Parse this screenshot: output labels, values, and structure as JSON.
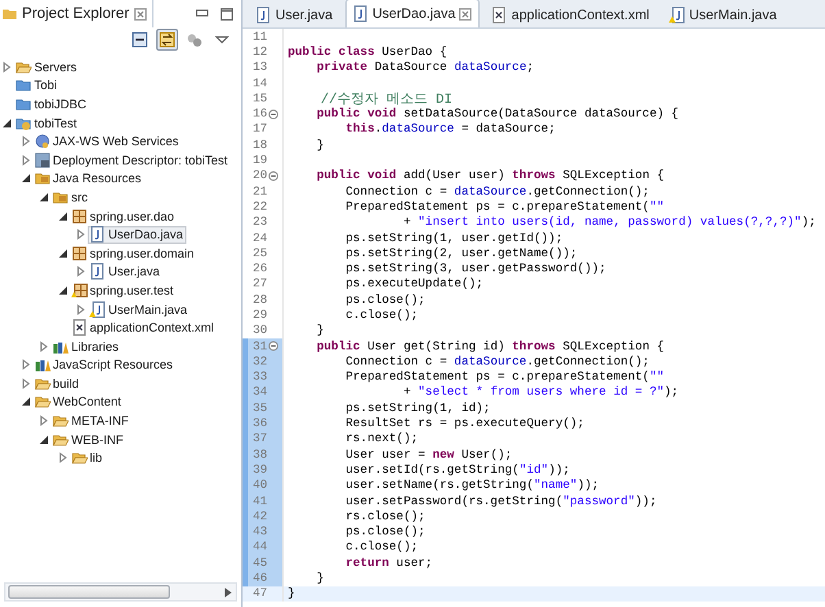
{
  "explorer": {
    "title": "Project Explorer",
    "toolbar": [
      {
        "kind": "collapse-all",
        "pressed": false
      },
      {
        "kind": "link-editor",
        "pressed": true
      },
      {
        "kind": "filters",
        "pressed": false
      },
      {
        "kind": "view-menu",
        "pressed": false
      }
    ],
    "tree": [
      {
        "label": "Servers",
        "kind": "open-folder",
        "expanded": false,
        "selected": false
      },
      {
        "label": "Tobi",
        "kind": "project",
        "selected": false
      },
      {
        "label": "tobiJDBC",
        "kind": "project",
        "selected": false
      },
      {
        "label": "tobiTest",
        "kind": "web-project",
        "expanded": true,
        "selected": false,
        "children": [
          {
            "label": "JAX-WS Web Services",
            "kind": "web-services",
            "expanded": false,
            "selected": false
          },
          {
            "label": "Deployment Descriptor: tobiTest",
            "kind": "descriptor",
            "expanded": false,
            "selected": false
          },
          {
            "label": "Java Resources",
            "kind": "java-resources",
            "expanded": true,
            "selected": false,
            "children": [
              {
                "label": "src",
                "kind": "source-folder",
                "expanded": true,
                "selected": false,
                "children": [
                  {
                    "label": "spring.user.dao",
                    "kind": "package",
                    "expanded": true,
                    "selected": false,
                    "children": [
                      {
                        "label": "UserDao.java",
                        "kind": "java-file",
                        "expanded": false,
                        "selected": true
                      }
                    ]
                  },
                  {
                    "label": "spring.user.domain",
                    "kind": "package",
                    "expanded": true,
                    "selected": false,
                    "children": [
                      {
                        "label": "User.java",
                        "kind": "java-file",
                        "expanded": false,
                        "selected": false
                      }
                    ]
                  },
                  {
                    "label": "spring.user.test",
                    "kind": "package-warning",
                    "expanded": true,
                    "selected": false,
                    "children": [
                      {
                        "label": "UserMain.java",
                        "kind": "java-file-warning",
                        "expanded": false,
                        "selected": false
                      }
                    ]
                  },
                  {
                    "label": "applicationContext.xml",
                    "kind": "xml-file",
                    "selected": false
                  }
                ]
              },
              {
                "label": "Libraries",
                "kind": "libraries",
                "expanded": false,
                "selected": false
              }
            ]
          },
          {
            "label": "JavaScript Resources",
            "kind": "libraries",
            "expanded": false,
            "selected": false
          },
          {
            "label": "build",
            "kind": "open-folder",
            "expanded": false,
            "selected": false
          },
          {
            "label": "WebContent",
            "kind": "open-folder",
            "expanded": true,
            "selected": false,
            "children": [
              {
                "label": "META-INF",
                "kind": "open-folder",
                "expanded": false,
                "selected": false
              },
              {
                "label": "WEB-INF",
                "kind": "open-folder",
                "expanded": true,
                "selected": false,
                "children": [
                  {
                    "label": "lib",
                    "kind": "open-folder",
                    "expanded": false,
                    "selected": false
                  }
                ]
              }
            ]
          }
        ]
      }
    ]
  },
  "editor": {
    "tabs": [
      {
        "label": "User.java",
        "kind": "java",
        "selected": false
      },
      {
        "label": "UserDao.java",
        "kind": "java",
        "selected": true
      },
      {
        "label": "applicationContext.xml",
        "kind": "xml",
        "selected": false
      },
      {
        "label": "UserMain.java",
        "kind": "java-warning",
        "selected": false
      }
    ],
    "lines": [
      {
        "number": "11",
        "fold": false,
        "marked": false,
        "current": false
      },
      {
        "number": "12",
        "fold": false,
        "marked": false,
        "current": false,
        "code": [
          {
            "kind": "kw",
            "text": "public class"
          },
          {
            "kind": "plain",
            "text": " UserDao {"
          }
        ]
      },
      {
        "number": "13",
        "fold": false,
        "marked": false,
        "current": false,
        "code": [
          {
            "kind": "kw",
            "text": "    private"
          },
          {
            "kind": "plain",
            "text": " DataSource "
          },
          {
            "kind": "field",
            "text": "dataSource"
          },
          {
            "kind": "plain",
            "text": ";"
          }
        ]
      },
      {
        "number": "14",
        "fold": false,
        "marked": false,
        "current": false
      },
      {
        "number": "15",
        "fold": false,
        "marked": false,
        "current": false,
        "code": [
          {
            "kind": "comment",
            "text": "    //수정자 메소드 DI"
          }
        ]
      },
      {
        "number": "16",
        "fold": true,
        "marked": false,
        "current": false,
        "code": [
          {
            "kind": "kw",
            "text": "    public void"
          },
          {
            "kind": "plain",
            "text": " setDataSource(DataSource dataSource) {"
          }
        ]
      },
      {
        "number": "17",
        "fold": false,
        "marked": false,
        "current": false,
        "code": [
          {
            "kind": "kw",
            "text": "        this"
          },
          {
            "kind": "plain",
            "text": "."
          },
          {
            "kind": "field",
            "text": "dataSource"
          },
          {
            "kind": "plain",
            "text": " = dataSource;"
          }
        ]
      },
      {
        "number": "18",
        "fold": false,
        "marked": false,
        "current": false,
        "code": [
          {
            "kind": "plain",
            "text": "    }"
          }
        ]
      },
      {
        "number": "19",
        "fold": false,
        "marked": false,
        "current": false
      },
      {
        "number": "20",
        "fold": true,
        "marked": false,
        "current": false,
        "code": [
          {
            "kind": "kw",
            "text": "    public void"
          },
          {
            "kind": "plain",
            "text": " add(User user) "
          },
          {
            "kind": "kw",
            "text": "throws"
          },
          {
            "kind": "plain",
            "text": " SQLException {"
          }
        ]
      },
      {
        "number": "21",
        "fold": false,
        "marked": false,
        "current": false,
        "code": [
          {
            "kind": "plain",
            "text": "        Connection c = "
          },
          {
            "kind": "field",
            "text": "dataSource"
          },
          {
            "kind": "plain",
            "text": ".getConnection();"
          }
        ]
      },
      {
        "number": "22",
        "fold": false,
        "marked": false,
        "current": false,
        "code": [
          {
            "kind": "plain",
            "text": "        PreparedStatement ps = c.prepareStatement("
          },
          {
            "kind": "str",
            "text": "\"\""
          }
        ]
      },
      {
        "number": "23",
        "fold": false,
        "marked": false,
        "current": false,
        "code": [
          {
            "kind": "plain",
            "text": "                + "
          },
          {
            "kind": "str",
            "text": "\"insert into users(id, name, password) values(?,?,?)\""
          },
          {
            "kind": "plain",
            "text": ");"
          }
        ]
      },
      {
        "number": "24",
        "fold": false,
        "marked": false,
        "current": false,
        "code": [
          {
            "kind": "plain",
            "text": "        ps.setString(1, user.getId());"
          }
        ]
      },
      {
        "number": "25",
        "fold": false,
        "marked": false,
        "current": false,
        "code": [
          {
            "kind": "plain",
            "text": "        ps.setString(2, user.getName());"
          }
        ]
      },
      {
        "number": "26",
        "fold": false,
        "marked": false,
        "current": false,
        "code": [
          {
            "kind": "plain",
            "text": "        ps.setString(3, user.getPassword());"
          }
        ]
      },
      {
        "number": "27",
        "fold": false,
        "marked": false,
        "current": false,
        "code": [
          {
            "kind": "plain",
            "text": "        ps.executeUpdate();"
          }
        ]
      },
      {
        "number": "28",
        "fold": false,
        "marked": false,
        "current": false,
        "code": [
          {
            "kind": "plain",
            "text": "        ps.close();"
          }
        ]
      },
      {
        "number": "29",
        "fold": false,
        "marked": false,
        "current": false,
        "code": [
          {
            "kind": "plain",
            "text": "        c.close();"
          }
        ]
      },
      {
        "number": "30",
        "fold": false,
        "marked": false,
        "current": false,
        "code": [
          {
            "kind": "plain",
            "text": "    }"
          }
        ]
      },
      {
        "number": "31",
        "fold": true,
        "marked": true,
        "current": false,
        "code": [
          {
            "kind": "kw",
            "text": "    public"
          },
          {
            "kind": "plain",
            "text": " User get(String id) "
          },
          {
            "kind": "kw",
            "text": "throws"
          },
          {
            "kind": "plain",
            "text": " SQLException {"
          }
        ]
      },
      {
        "number": "32",
        "fold": false,
        "marked": true,
        "current": false,
        "code": [
          {
            "kind": "plain",
            "text": "        Connection c = "
          },
          {
            "kind": "field",
            "text": "dataSource"
          },
          {
            "kind": "plain",
            "text": ".getConnection();"
          }
        ]
      },
      {
        "number": "33",
        "fold": false,
        "marked": true,
        "current": false,
        "code": [
          {
            "kind": "plain",
            "text": "        PreparedStatement ps = c.prepareStatement("
          },
          {
            "kind": "str",
            "text": "\"\""
          }
        ]
      },
      {
        "number": "34",
        "fold": false,
        "marked": true,
        "current": false,
        "code": [
          {
            "kind": "plain",
            "text": "                + "
          },
          {
            "kind": "str",
            "text": "\"select * from users where id = ?\""
          },
          {
            "kind": "plain",
            "text": ");"
          }
        ]
      },
      {
        "number": "35",
        "fold": false,
        "marked": true,
        "current": false,
        "code": [
          {
            "kind": "plain",
            "text": "        ps.setString(1, id);"
          }
        ]
      },
      {
        "number": "36",
        "fold": false,
        "marked": true,
        "current": false,
        "code": [
          {
            "kind": "plain",
            "text": "        ResultSet rs = ps.executeQuery();"
          }
        ]
      },
      {
        "number": "37",
        "fold": false,
        "marked": true,
        "current": false,
        "code": [
          {
            "kind": "plain",
            "text": "        rs.next();"
          }
        ]
      },
      {
        "number": "38",
        "fold": false,
        "marked": true,
        "current": false,
        "code": [
          {
            "kind": "plain",
            "text": "        User user = "
          },
          {
            "kind": "kw",
            "text": "new"
          },
          {
            "kind": "plain",
            "text": " User();"
          }
        ]
      },
      {
        "number": "39",
        "fold": false,
        "marked": true,
        "current": false,
        "code": [
          {
            "kind": "plain",
            "text": "        user.setId(rs.getString("
          },
          {
            "kind": "str",
            "text": "\"id\""
          },
          {
            "kind": "plain",
            "text": "));"
          }
        ]
      },
      {
        "number": "40",
        "fold": false,
        "marked": true,
        "current": false,
        "code": [
          {
            "kind": "plain",
            "text": "        user.setName(rs.getString("
          },
          {
            "kind": "str",
            "text": "\"name\""
          },
          {
            "kind": "plain",
            "text": "));"
          }
        ]
      },
      {
        "number": "41",
        "fold": false,
        "marked": true,
        "current": false,
        "code": [
          {
            "kind": "plain",
            "text": "        user.setPassword(rs.getString("
          },
          {
            "kind": "str",
            "text": "\"password\""
          },
          {
            "kind": "plain",
            "text": "));"
          }
        ]
      },
      {
        "number": "42",
        "fold": false,
        "marked": true,
        "current": false,
        "code": [
          {
            "kind": "plain",
            "text": "        rs.close();"
          }
        ]
      },
      {
        "number": "43",
        "fold": false,
        "marked": true,
        "current": false,
        "code": [
          {
            "kind": "plain",
            "text": "        ps.close();"
          }
        ]
      },
      {
        "number": "44",
        "fold": false,
        "marked": true,
        "current": false,
        "code": [
          {
            "kind": "plain",
            "text": "        c.close();"
          }
        ]
      },
      {
        "number": "45",
        "fold": false,
        "marked": true,
        "current": false,
        "code": [
          {
            "kind": "kw",
            "text": "        return"
          },
          {
            "kind": "plain",
            "text": " user;"
          }
        ]
      },
      {
        "number": "46",
        "fold": false,
        "marked": true,
        "current": false,
        "code": [
          {
            "kind": "plain",
            "text": "    }"
          }
        ]
      },
      {
        "number": "47",
        "fold": false,
        "marked": false,
        "current": true,
        "code": [
          {
            "kind": "plain",
            "text": "}"
          }
        ]
      }
    ]
  }
}
